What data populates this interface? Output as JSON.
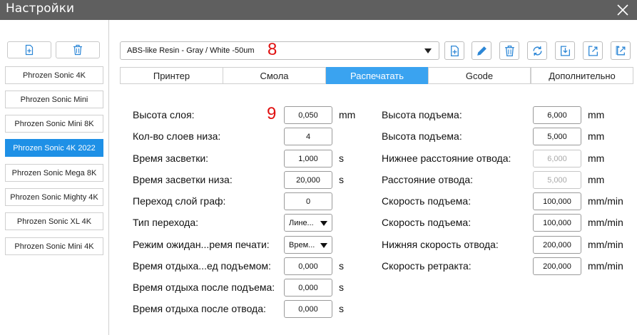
{
  "window": {
    "title": "Настройки"
  },
  "sidebar": {
    "printers": [
      {
        "label": "Phrozen Sonic 4K",
        "selected": false
      },
      {
        "label": "Phrozen Sonic Mini",
        "selected": false
      },
      {
        "label": "Phrozen Sonic Mini 8K",
        "selected": false
      },
      {
        "label": "Phrozen Sonic 4K 2022",
        "selected": true
      },
      {
        "label": "Phrozen Sonic Mega 8K",
        "selected": false
      },
      {
        "label": "Phrozen Sonic Mighty 4K",
        "selected": false
      },
      {
        "label": "Phrozen Sonic XL 4K",
        "selected": false
      },
      {
        "label": "Phrozen Sonic Mini 4K",
        "selected": false
      }
    ]
  },
  "profile": {
    "selected": "ABS-like Resin - Gray / White -50um"
  },
  "annotations": {
    "marker_profile": "8",
    "marker_layer": "9"
  },
  "tabs": [
    {
      "label": "Принтер",
      "active": false
    },
    {
      "label": "Смола",
      "active": false
    },
    {
      "label": "Распечатать",
      "active": true
    },
    {
      "label": "Gcode",
      "active": false
    },
    {
      "label": "Дополнительно",
      "active": false
    }
  ],
  "left_settings": [
    {
      "label": "Высота слоя:",
      "value": "0,050",
      "unit": "mm",
      "type": "input"
    },
    {
      "label": "Кол-во слоев низа:",
      "value": "4",
      "unit": "",
      "type": "input"
    },
    {
      "label": "Время засветки:",
      "value": "1,000",
      "unit": "s",
      "type": "input"
    },
    {
      "label": "Время засветки низа:",
      "value": "20,000",
      "unit": "s",
      "type": "input"
    },
    {
      "label": "Переход слой граф:",
      "value": "0",
      "unit": "",
      "type": "input"
    },
    {
      "label": "Тип перехода:",
      "value": "Лине...",
      "unit": "",
      "type": "select"
    },
    {
      "label": "Режим ожидан...ремя печати:",
      "value": "Врем...",
      "unit": "",
      "type": "select"
    },
    {
      "label": "Время отдыха...ед подъемом:",
      "value": "0,000",
      "unit": "s",
      "type": "input"
    },
    {
      "label": "Время отдыха после подъема:",
      "value": "0,000",
      "unit": "s",
      "type": "input"
    },
    {
      "label": "Время отдыха после отвода:",
      "value": "0,000",
      "unit": "s",
      "type": "input"
    }
  ],
  "right_settings": [
    {
      "label": "Высота подъема:",
      "value": "6,000",
      "unit": "mm",
      "disabled": false
    },
    {
      "label": "Высота подъема:",
      "value": "5,000",
      "unit": "mm",
      "disabled": false
    },
    {
      "label": "Нижнее расстояние отвода:",
      "value": "6,000",
      "unit": "mm",
      "disabled": true
    },
    {
      "label": "Расстояние отвода:",
      "value": "5,000",
      "unit": "mm",
      "disabled": true
    },
    {
      "label": "Скорость подъема:",
      "value": "100,000",
      "unit": "mm/min",
      "disabled": false
    },
    {
      "label": "Скорость подъема:",
      "value": "100,000",
      "unit": "mm/min",
      "disabled": false
    },
    {
      "label": "Нижняя скорость отвода:",
      "value": "200,000",
      "unit": "mm/min",
      "disabled": false
    },
    {
      "label": "Скорость ретракта:",
      "value": "200,000",
      "unit": "mm/min",
      "disabled": false
    }
  ],
  "icons": {
    "close": "close-icon",
    "add": "add-file-icon",
    "delete": "trash-icon",
    "edit": "pencil-icon",
    "refresh": "refresh-icon",
    "import": "import-icon",
    "export": "export-icon",
    "export_all": "export-all-icon"
  },
  "colors": {
    "accent": "#1e90e6",
    "tab_active": "#3aa3f0",
    "titlebar": "#5f5f5f",
    "marker": "#e01010"
  }
}
